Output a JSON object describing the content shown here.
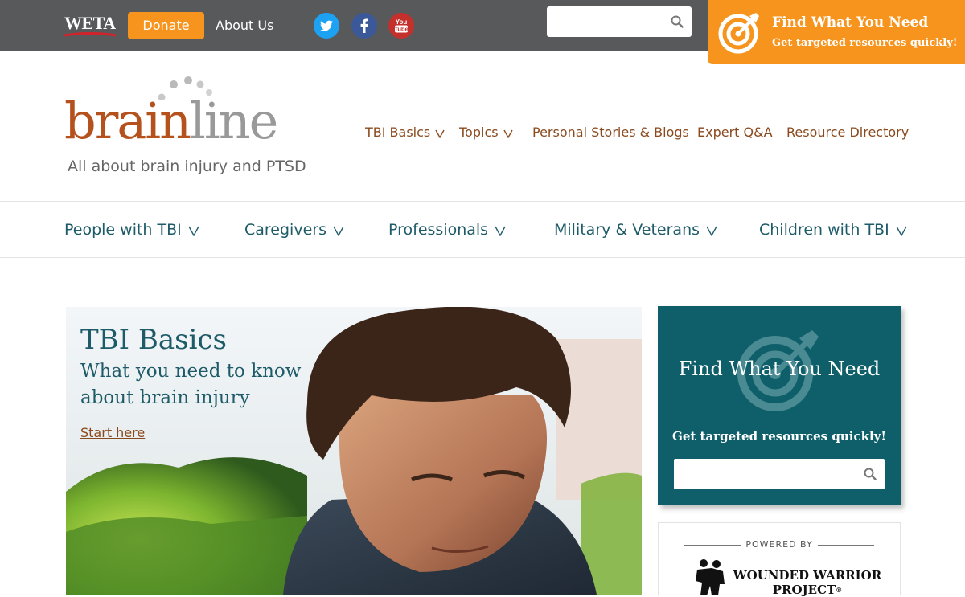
{
  "topbar": {
    "weta_logo": "WETA",
    "donate_label": "Donate",
    "about_label": "About Us",
    "social": [
      "twitter-icon",
      "facebook-icon",
      "youtube-icon"
    ],
    "search_value": "",
    "find_title": "Find What You Need",
    "find_sub": "Get targeted resources quickly!"
  },
  "brand": {
    "brain": "brain",
    "line": "line",
    "tagline": "All about brain injury and PTSD"
  },
  "main_nav": [
    {
      "label": "TBI Basics"
    },
    {
      "label": "Topics"
    },
    {
      "label": "Personal Stories & Blogs"
    },
    {
      "label": "Expert Q&A"
    },
    {
      "label": "Resource Directory"
    }
  ],
  "audience_nav": [
    {
      "label": "People with TBI"
    },
    {
      "label": "Caregivers"
    },
    {
      "label": "Professionals"
    },
    {
      "label": "Military & Veterans"
    },
    {
      "label": "Children with TBI"
    }
  ],
  "hero": {
    "title": "TBI Basics",
    "subtitle": "What you need to know about brain injury",
    "link": "Start here"
  },
  "sidebox": {
    "title": "Find What You Need",
    "subtitle": "Get targeted resources quickly!",
    "search_value": ""
  },
  "powered": {
    "label": "POWERED BY",
    "line1": "WOUNDED WARRIOR",
    "line2": "PROJECT",
    "registered": "®"
  },
  "colors": {
    "topbar": "#58595b",
    "orange": "#f7941d",
    "teal": "#0e5f6a",
    "brown": "#b5511c",
    "nav_text": "#8a4a1e",
    "aud_text": "#1e5b68"
  }
}
